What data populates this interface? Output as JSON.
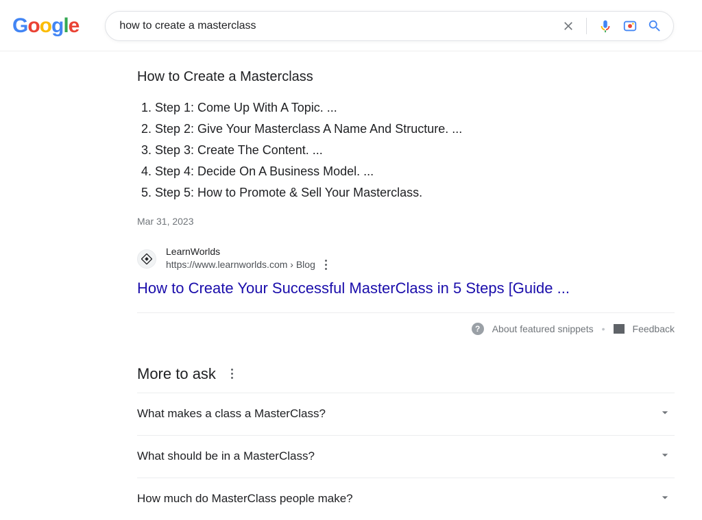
{
  "header": {
    "logo_letters": [
      "G",
      "o",
      "o",
      "g",
      "l",
      "e"
    ],
    "search_value": "how to create a masterclass"
  },
  "snippet": {
    "title": "How to Create a Masterclass",
    "steps": [
      "Step 1: Come Up With A Topic. ...",
      "Step 2: Give Your Masterclass A Name And Structure. ...",
      "Step 3: Create The Content. ...",
      "Step 4: Decide On A Business Model. ...",
      "Step 5: How to Promote & Sell Your Masterclass."
    ],
    "date": "Mar 31, 2023"
  },
  "source": {
    "name": "LearnWorlds",
    "url": "https://www.learnworlds.com › Blog",
    "result_title": "How to Create Your Successful MasterClass in 5 Steps [Guide ..."
  },
  "footer_links": {
    "about": "About featured snippets",
    "feedback": "Feedback"
  },
  "moreToAsk": {
    "heading": "More to ask",
    "questions": [
      "What makes a class a MasterClass?",
      "What should be in a MasterClass?",
      "How much do MasterClass people make?"
    ]
  }
}
